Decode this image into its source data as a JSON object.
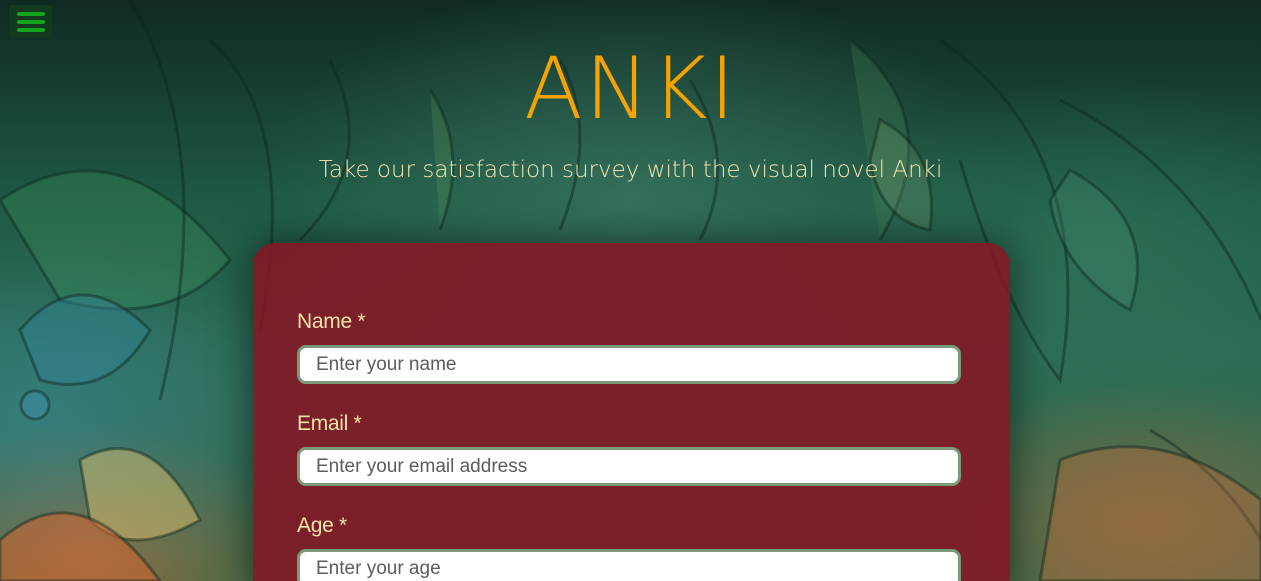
{
  "nav": {
    "menu_icon": "hamburger-menu-icon"
  },
  "header": {
    "title": "ANKI",
    "subtitle": "Take our satisfaction survey with the visual novel Anki"
  },
  "form": {
    "fields": [
      {
        "label": "Name *",
        "placeholder": "Enter your name",
        "value": ""
      },
      {
        "label": "Email *",
        "placeholder": "Enter your email address",
        "value": ""
      },
      {
        "label": "Age *",
        "placeholder": "Enter your age",
        "value": ""
      }
    ]
  },
  "colors": {
    "title": "#f6a200",
    "subtitle": "#f3e7b4",
    "label": "#f6e3a8",
    "card": "#871423",
    "menu_bars": "#13a31f",
    "input_border": "#7a9a7a"
  }
}
